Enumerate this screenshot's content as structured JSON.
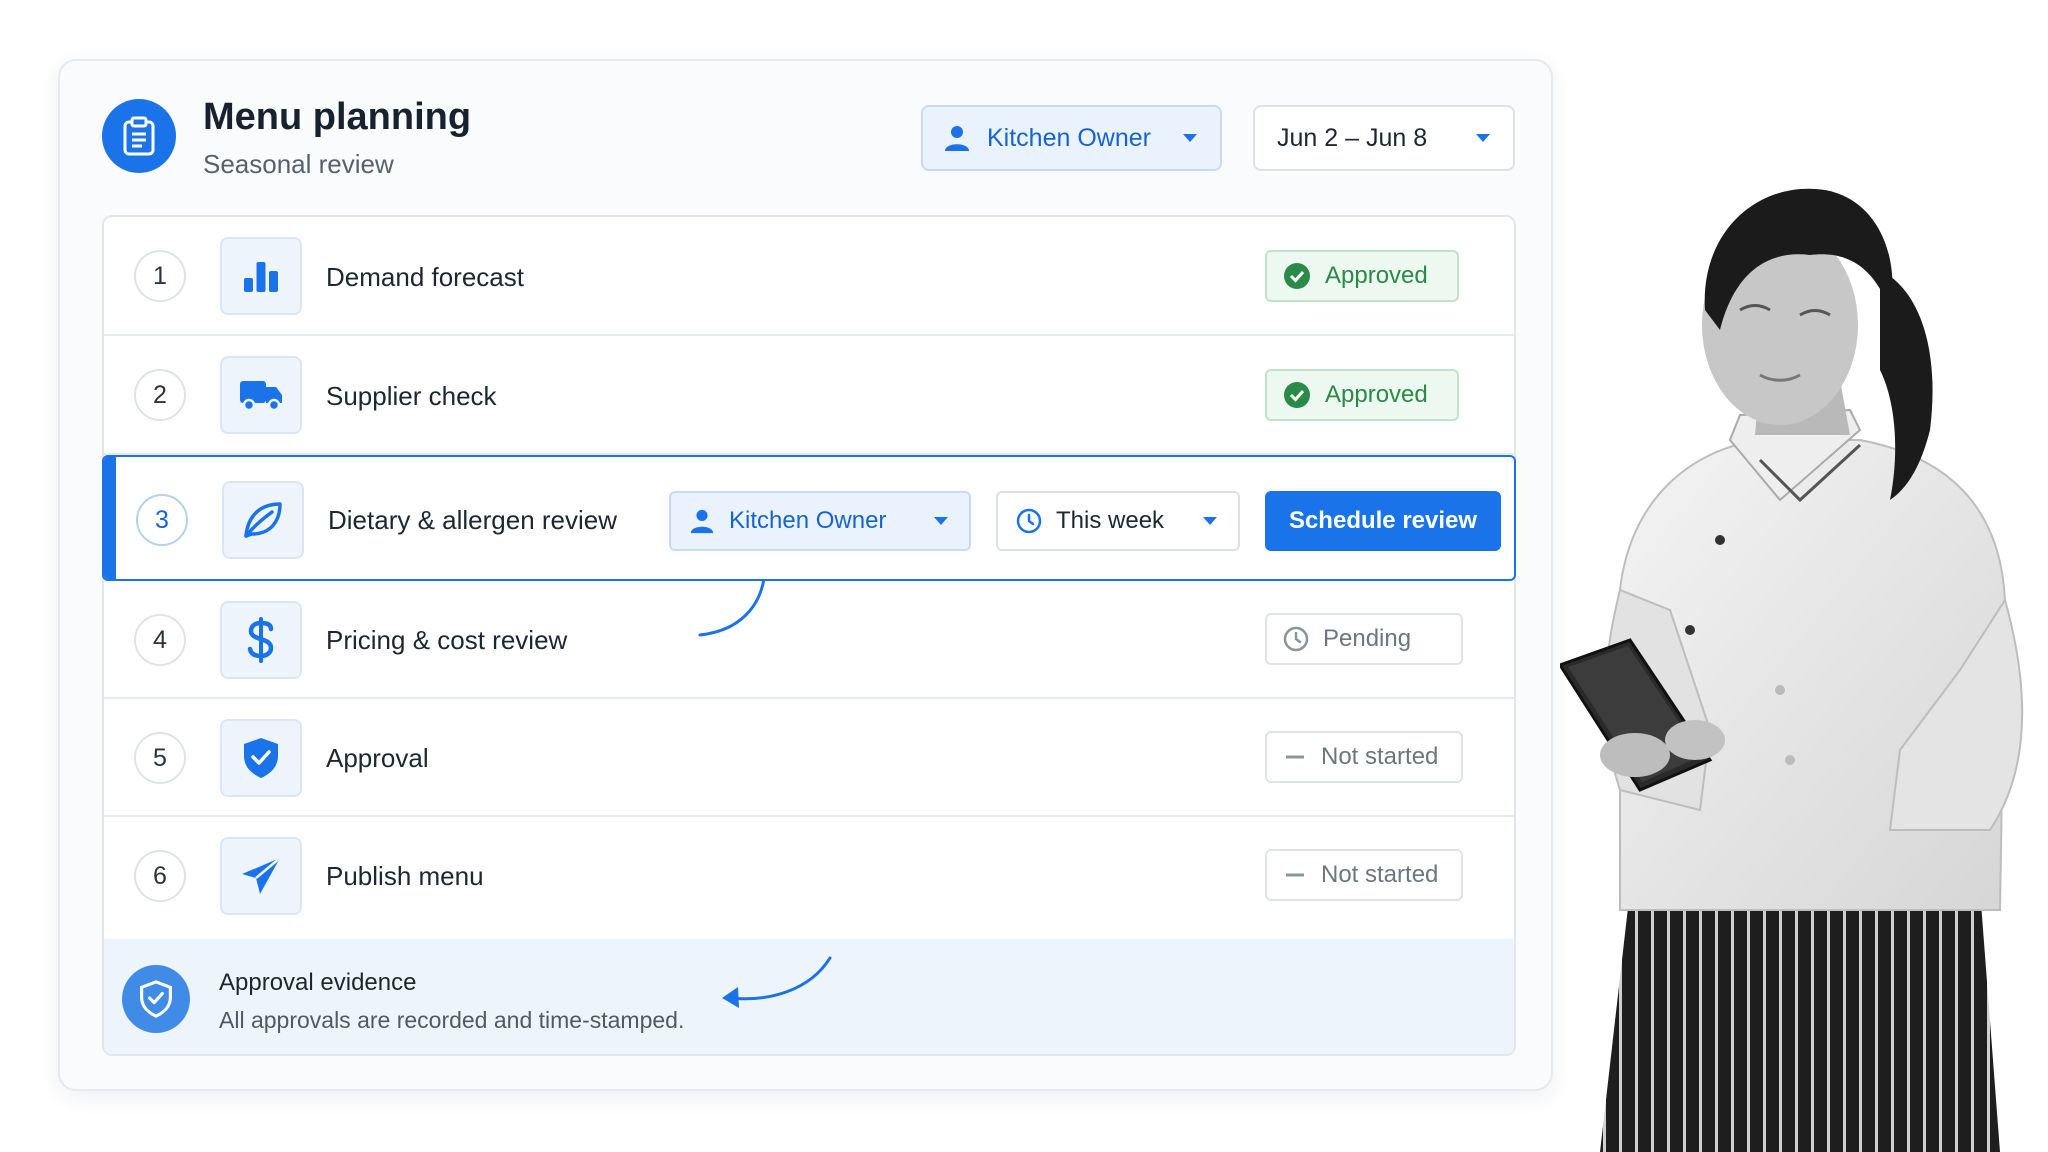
{
  "header": {
    "title": "Menu planning",
    "subtitle": "Seasonal review",
    "owner_dropdown": "Kitchen Owner",
    "date_range": "Jun 2 – Jun 8"
  },
  "steps": [
    {
      "num": "1",
      "label": "Demand forecast",
      "status": "Approved",
      "icon": "bar-chart-icon"
    },
    {
      "num": "2",
      "label": "Supplier check",
      "status": "Approved",
      "icon": "truck-icon"
    },
    {
      "num": "3",
      "label": "Dietary & allergen review",
      "assignee": "Kitchen Owner",
      "when": "This week",
      "action": "Schedule review",
      "icon": "leaf-icon"
    },
    {
      "num": "4",
      "label": "Pricing & cost review",
      "status": "Pending",
      "icon": "dollar-icon"
    },
    {
      "num": "5",
      "label": "Approval",
      "status": "Not started",
      "icon": "shield-check-icon"
    },
    {
      "num": "6",
      "label": "Publish menu",
      "status": "Not started",
      "icon": "send-icon"
    }
  ],
  "evidence": {
    "title": "Approval evidence",
    "description": "All approvals are recorded and time-stamped."
  },
  "colors": {
    "accent": "#1a73e8",
    "approved": "#2a8a48",
    "muted": "#6b7682"
  }
}
